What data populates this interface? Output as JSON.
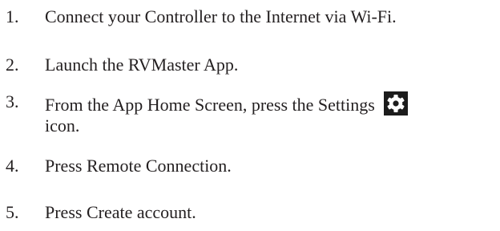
{
  "steps": [
    {
      "number": "1.",
      "text": "Connect your Controller to the Internet via Wi-Fi."
    },
    {
      "number": "2.",
      "text": "Launch the RVMaster App."
    },
    {
      "number": "3.",
      "text": "From the App Home Screen, press the Settings",
      "icon": "gear-icon",
      "text_after": "icon."
    },
    {
      "number": "4.",
      "text": "Press Remote Connection."
    },
    {
      "number": "5.",
      "text": "Press Create account."
    }
  ]
}
